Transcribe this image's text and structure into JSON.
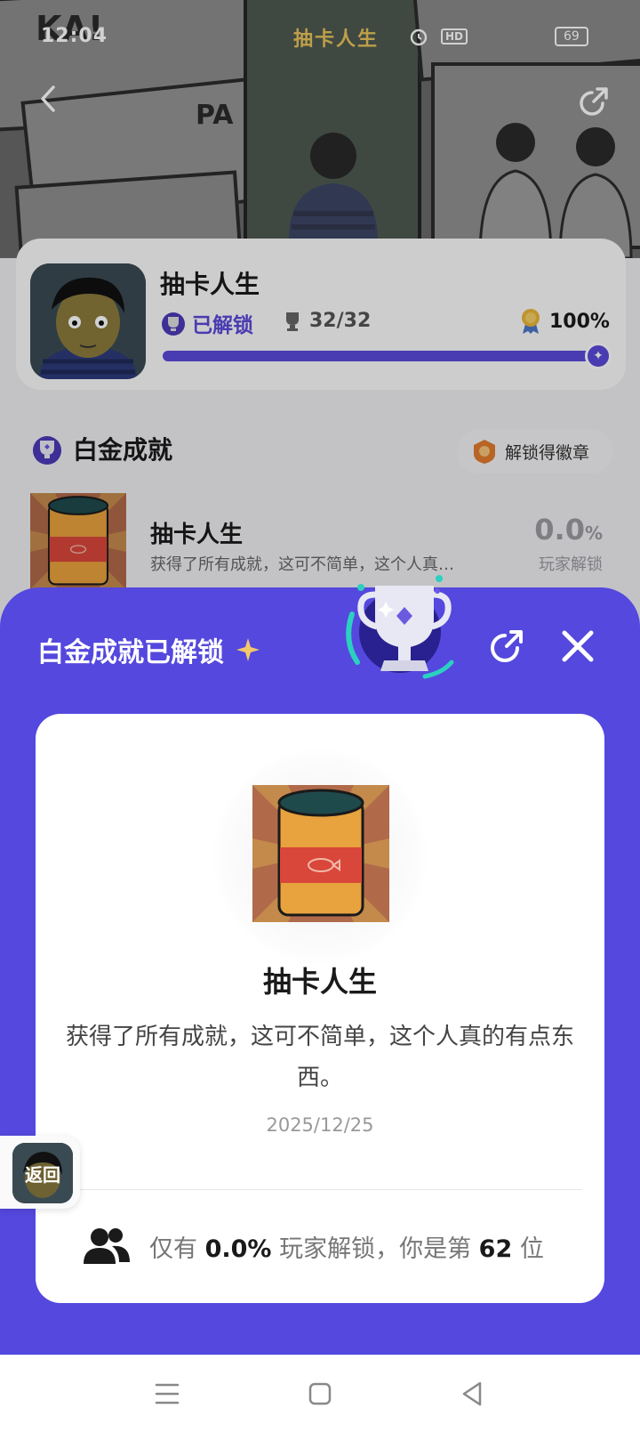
{
  "status_bar": {
    "time": "12:04",
    "title": "抽卡人生",
    "hd_label": "HD",
    "battery": "69"
  },
  "game": {
    "name": "抽卡人生",
    "unlocked_label": "已解锁",
    "trophy_count": "32/32",
    "completion": "100%",
    "progress_fraction": 1.0
  },
  "platinum_section": {
    "title": "白金成就",
    "badge_button_label": "解锁得徽章"
  },
  "achievement_row": {
    "name": "抽卡人生",
    "description": "获得了所有成就，这可不简单，这个人真…",
    "rate_value": "0.0",
    "rate_unit": "%",
    "rate_label": "玩家解锁"
  },
  "sheet": {
    "title": "白金成就已解锁",
    "card": {
      "name": "抽卡人生",
      "description": "获得了所有成就，这可不简单，这个人真的有点东西。",
      "date": "2025/12/25",
      "foot_prefix": "仅有",
      "foot_rate": "0.0%",
      "foot_middle": "玩家解锁，你是第",
      "foot_rank": "62",
      "foot_suffix": "位"
    }
  },
  "float_back": {
    "label": "返回"
  },
  "colors": {
    "accent": "#5448de",
    "progress_track": "#d8d4f5"
  },
  "icons": {
    "nav_menu": "menu-icon",
    "nav_home": "home-icon",
    "nav_back": "back-icon"
  }
}
